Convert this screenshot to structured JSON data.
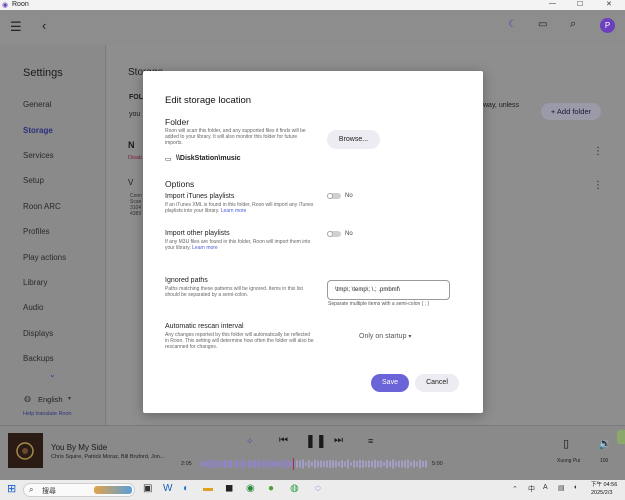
{
  "window": {
    "title": "Roon",
    "minimize": "—",
    "maximize": "☐",
    "close": "✕"
  },
  "topbar": {
    "avatar_letter": "P"
  },
  "sidebar": {
    "title": "Settings",
    "items": [
      {
        "label": "General"
      },
      {
        "label": "Storage"
      },
      {
        "label": "Services"
      },
      {
        "label": "Setup"
      },
      {
        "label": "Roon ARC"
      },
      {
        "label": "Profiles"
      },
      {
        "label": "Play actions"
      },
      {
        "label": "Library"
      },
      {
        "label": "Audio"
      },
      {
        "label": "Displays"
      },
      {
        "label": "Backups"
      }
    ],
    "language": "English",
    "help_link": "Help translate Roon"
  },
  "main": {
    "title": "Storage",
    "folder_label": "FOL",
    "folder_text": "you",
    "intro_tail": "way, unless",
    "add_folder": "+ Add folder",
    "row1_letter": "N",
    "row1_status": "Disab",
    "row2_letter": "V",
    "row2_lines": [
      "Conn",
      "Scan",
      "3104",
      "4389"
    ]
  },
  "modal": {
    "title": "Edit storage location",
    "folder": {
      "heading": "Folder",
      "desc": "Roon will scan this folder, and any supported files it finds will be added to your library. It will also monitor this folder for future imports.",
      "browse": "Browse...",
      "path": "\\\\DiskStation\\music"
    },
    "options": {
      "heading": "Options",
      "itunes": {
        "label": "Import iTunes playlists",
        "desc": "If an iTunes XML is found in this folder, Roon will import any iTunes playlists into your library.",
        "link": "Learn more",
        "state": "No"
      },
      "other": {
        "label": "Import other playlists",
        "desc": "If any M3U files are found in this folder, Roon will import them into your library.",
        "link": "Learn more",
        "state": "No"
      }
    },
    "ignored": {
      "label": "Ignored paths",
      "desc": "Paths matching these patterns will be ignored. Items in this list should be separated by a semi-colon.",
      "value": "\\tmp\\; \\temp\\; \\.; .pmbmf\\",
      "hint": "Separate multiple items with a semi-colon ( ; )"
    },
    "rescan": {
      "label": "Automatic rescan interval",
      "desc": "Any changes reported by this folder will automatically be reflected in Roon. This setting will determine how often the folder will also be rescanned for changes.",
      "value": "Only on startup"
    },
    "save": "Save",
    "cancel": "Cancel"
  },
  "player": {
    "track": "You By My Side",
    "artists": "Chris Squire, Patrick Moraz, Bill Bruford, Jon...",
    "elapsed": "2:05",
    "total": "5:00",
    "zone": "Xuong Pui",
    "volume": "100",
    "progress": 0.41
  },
  "taskbar": {
    "search": "搜尋",
    "time": "下午 04:56",
    "date": "2025/2/3"
  }
}
